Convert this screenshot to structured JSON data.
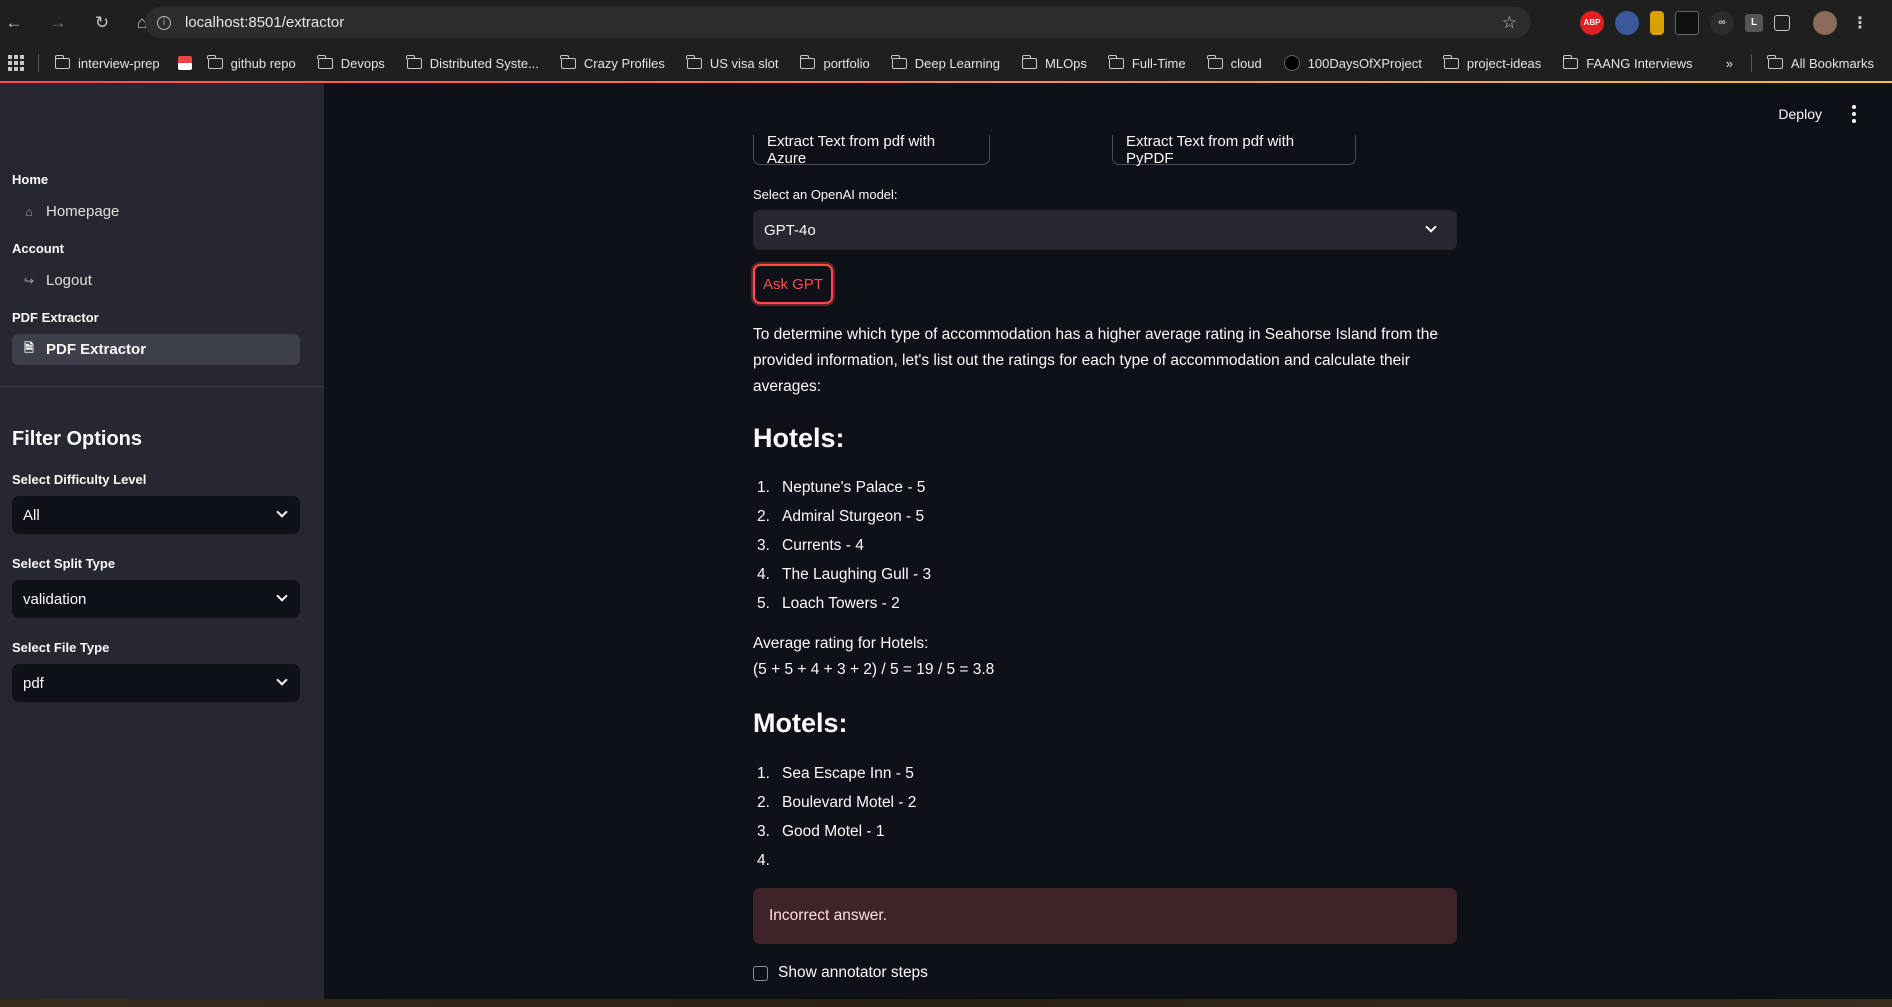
{
  "browser": {
    "url": "localhost:8501/extractor",
    "bookmarks": [
      "interview-prep",
      "github repo",
      "Devops",
      "Distributed Syste...",
      "Crazy Profiles",
      "US visa slot",
      "portfolio",
      "Deep Learning",
      "MLOps",
      "Full-Time",
      "cloud",
      "100DaysOfXProject",
      "project-ideas",
      "FAANG Interviews"
    ],
    "all_bookmarks": "All Bookmarks",
    "overflow": "»",
    "extensions": {
      "abp": "ABP",
      "l": "L"
    }
  },
  "sidebar": {
    "sections": [
      {
        "title": "Home",
        "item": "Homepage"
      },
      {
        "title": "Account",
        "item": "Logout"
      },
      {
        "title": "PDF Extractor",
        "item": "PDF Extractor"
      }
    ],
    "filter_title": "Filter Options",
    "filters": [
      {
        "label": "Select Difficulty Level",
        "value": "All"
      },
      {
        "label": "Select Split Type",
        "value": "validation"
      },
      {
        "label": "Select File Type",
        "value": "pdf"
      }
    ]
  },
  "header": {
    "deploy": "Deploy"
  },
  "main": {
    "btn_azure": "Extract Text from pdf with Azure",
    "btn_pypdf": "Extract Text from pdf with PyPDF",
    "model_label": "Select an OpenAI model:",
    "model_value": "GPT-4o",
    "ask_button": "Ask GPT",
    "intro": "To determine which type of accommodation has a higher average rating in Seahorse Island from the provided information, let's list out the ratings for each type of accommodation and calculate their averages:",
    "hotels_title": "Hotels:",
    "hotels": [
      {
        "n": "1.",
        "text": "Neptune's Palace - 5"
      },
      {
        "n": "2.",
        "text": "Admiral Sturgeon - 5"
      },
      {
        "n": "3.",
        "text": "Currents - 4"
      },
      {
        "n": "4.",
        "text": "The Laughing Gull - 3"
      },
      {
        "n": "5.",
        "text": "Loach Towers - 2"
      }
    ],
    "hotels_avg_label": "Average rating for Hotels:",
    "hotels_avg_calc": "(5 + 5 + 4 + 3 + 2) / 5 = 19 / 5 = 3.8",
    "motels_title": "Motels:",
    "motels": [
      {
        "n": "1.",
        "text": "Sea Escape Inn - 5"
      },
      {
        "n": "2.",
        "text": "Boulevard Motel - 2"
      },
      {
        "n": "3.",
        "text": "Good Motel - 1"
      },
      {
        "n": "4.",
        "text": ""
      }
    ],
    "alert": "Incorrect answer.",
    "checkbox_label": "Show annotator steps"
  }
}
